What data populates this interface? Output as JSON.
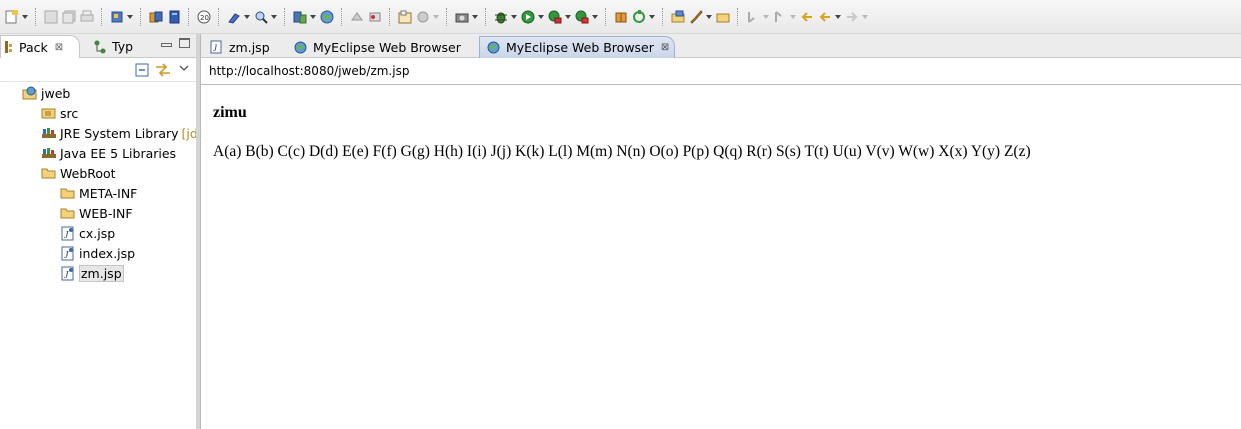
{
  "toolbar": {
    "icons": [
      "new-icon",
      "save-icon",
      "save-all-icon",
      "print-icon",
      "new-web-project-icon",
      "deploy-icon",
      "server-icon",
      "open-type-icon",
      "search-icon",
      "open-resource-icon",
      "run-server-icon",
      "browser-icon",
      "back-nav-icon",
      "forward-nav-icon",
      "properties-icon",
      "wizard-icon",
      "camera-icon",
      "debug-icon",
      "run-icon",
      "run-external-icon",
      "run-ext-tools-icon",
      "package-icon",
      "refresh-icon",
      "open-folder-icon",
      "brush-icon",
      "folder-icon",
      "next-annotation-icon",
      "prev-annotation-icon",
      "last-edit-icon",
      "back-icon",
      "forward-icon"
    ]
  },
  "left_view": {
    "tabs": [
      {
        "label": "Pack",
        "icon": "package-explorer-icon",
        "close": "⊠"
      },
      {
        "label": "Typ",
        "icon": "hierarchy-icon"
      }
    ],
    "tree": [
      {
        "label": "jweb",
        "icon": "web-project-icon",
        "level": 0
      },
      {
        "label": "src",
        "icon": "source-folder-icon",
        "level": 1
      },
      {
        "label": "JRE System Library",
        "hint": "[jdk",
        "icon": "library-icon",
        "level": 1
      },
      {
        "label": "Java EE 5 Libraries",
        "icon": "library-icon",
        "level": 1
      },
      {
        "label": "WebRoot",
        "icon": "folder-icon",
        "level": 1
      },
      {
        "label": "META-INF",
        "icon": "folder-icon",
        "level": 2
      },
      {
        "label": "WEB-INF",
        "icon": "folder-icon",
        "level": 2
      },
      {
        "label": "cx.jsp",
        "icon": "jsp-file-icon",
        "level": 2
      },
      {
        "label": "index.jsp",
        "icon": "jsp-file-icon",
        "level": 2
      },
      {
        "label": "zm.jsp",
        "icon": "jsp-file-icon",
        "level": 2,
        "selected": true
      }
    ]
  },
  "editor": {
    "tabs": [
      {
        "label": "zm.jsp",
        "icon": "jsp-file-icon"
      },
      {
        "label": "MyEclipse Web Browser",
        "icon": "globe-icon"
      },
      {
        "label": "MyEclipse Web Browser",
        "icon": "globe-icon",
        "active": true,
        "close": "⊠"
      }
    ],
    "url": "http://localhost:8080/jweb/zm.jsp",
    "page_heading": "zimu",
    "page_text": "A(a) B(b) C(c) D(d) E(e) F(f) G(g) H(h) I(i) J(j) K(k) L(l) M(m) N(n) O(o) P(p) Q(q) R(r) S(s) T(t) U(u) V(v) W(w) X(x) Y(y) Z(z)"
  }
}
